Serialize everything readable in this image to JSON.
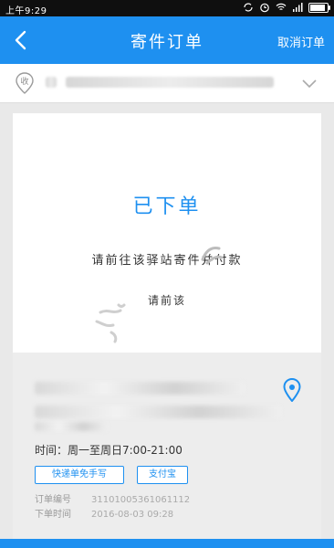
{
  "status_bar": {
    "time": "上午9:29"
  },
  "nav": {
    "title": "寄件订单",
    "cancel_label": "取消订单"
  },
  "address": {
    "badge": "收"
  },
  "order": {
    "status": "已下单",
    "instruction": "请前往该驿站寄件并付款",
    "sub": "请前该"
  },
  "station": {
    "hours": "时间：周一至周日7:00-21:00",
    "tags": [
      "快递单免手写",
      "支付宝"
    ],
    "meta": [
      {
        "label": "订单编号",
        "value": "31101005361061112"
      },
      {
        "label": "下单时间",
        "value": "2016-08-03 09:28"
      }
    ]
  },
  "colors": {
    "brand": "#1e90f0"
  }
}
